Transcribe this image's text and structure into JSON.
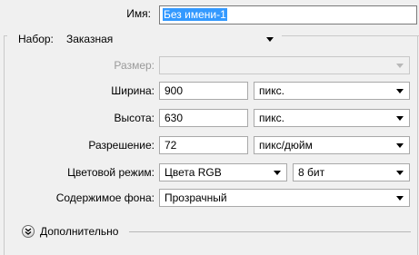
{
  "name": {
    "label": "Имя:",
    "value": "Без имени-1"
  },
  "preset": {
    "label": "Набор:",
    "value": "Заказная"
  },
  "size": {
    "label": "Размер:",
    "value": ""
  },
  "width": {
    "label": "Ширина:",
    "value": "900",
    "unit": "пикс."
  },
  "height": {
    "label": "Высота:",
    "value": "630",
    "unit": "пикс."
  },
  "resolution": {
    "label": "Разрешение:",
    "value": "72",
    "unit": "пикс/дюйм"
  },
  "color_mode": {
    "label": "Цветовой режим:",
    "value": "Цвета RGB",
    "depth": "8 бит"
  },
  "background": {
    "label": "Содержимое фона:",
    "value": "Прозрачный"
  },
  "advanced": {
    "label": "Дополнительно"
  },
  "colors": {
    "selection": "#3399ff",
    "field_border": "#a9a9a9",
    "window_bg": "#f0f0f0"
  }
}
